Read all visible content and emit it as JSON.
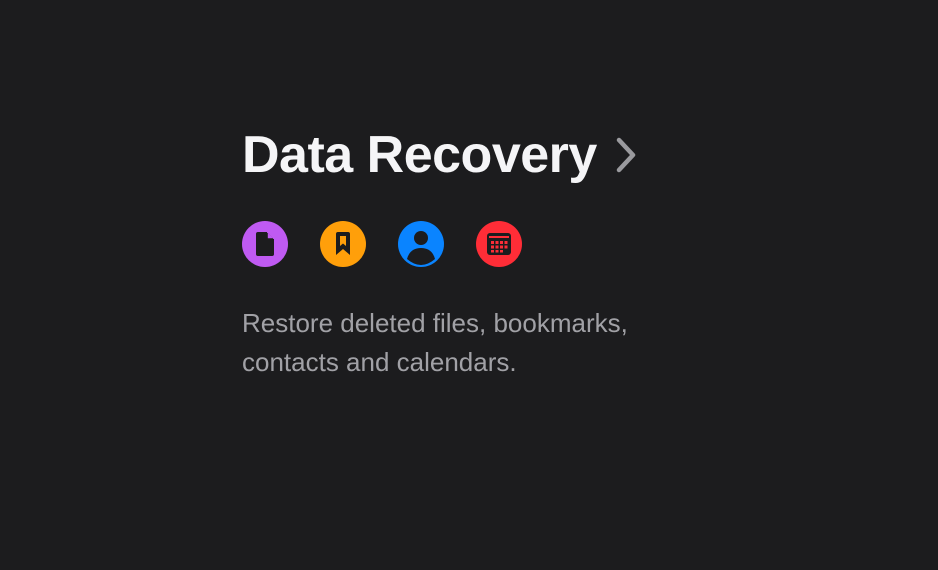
{
  "section": {
    "title": "Data Recovery",
    "description": "Restore deleted files, bookmarks, contacts and calendars."
  },
  "icons": [
    {
      "name": "file-icon",
      "color": "#bf5af2"
    },
    {
      "name": "bookmark-icon",
      "color": "#ff9f0a"
    },
    {
      "name": "contact-icon",
      "color": "#0a84ff"
    },
    {
      "name": "calendar-icon",
      "color": "#ff2d37"
    }
  ],
  "colors": {
    "background": "#1c1c1e",
    "title": "#f5f5f7",
    "description": "#a1a1a6",
    "chevron": "#9a9a9e"
  }
}
